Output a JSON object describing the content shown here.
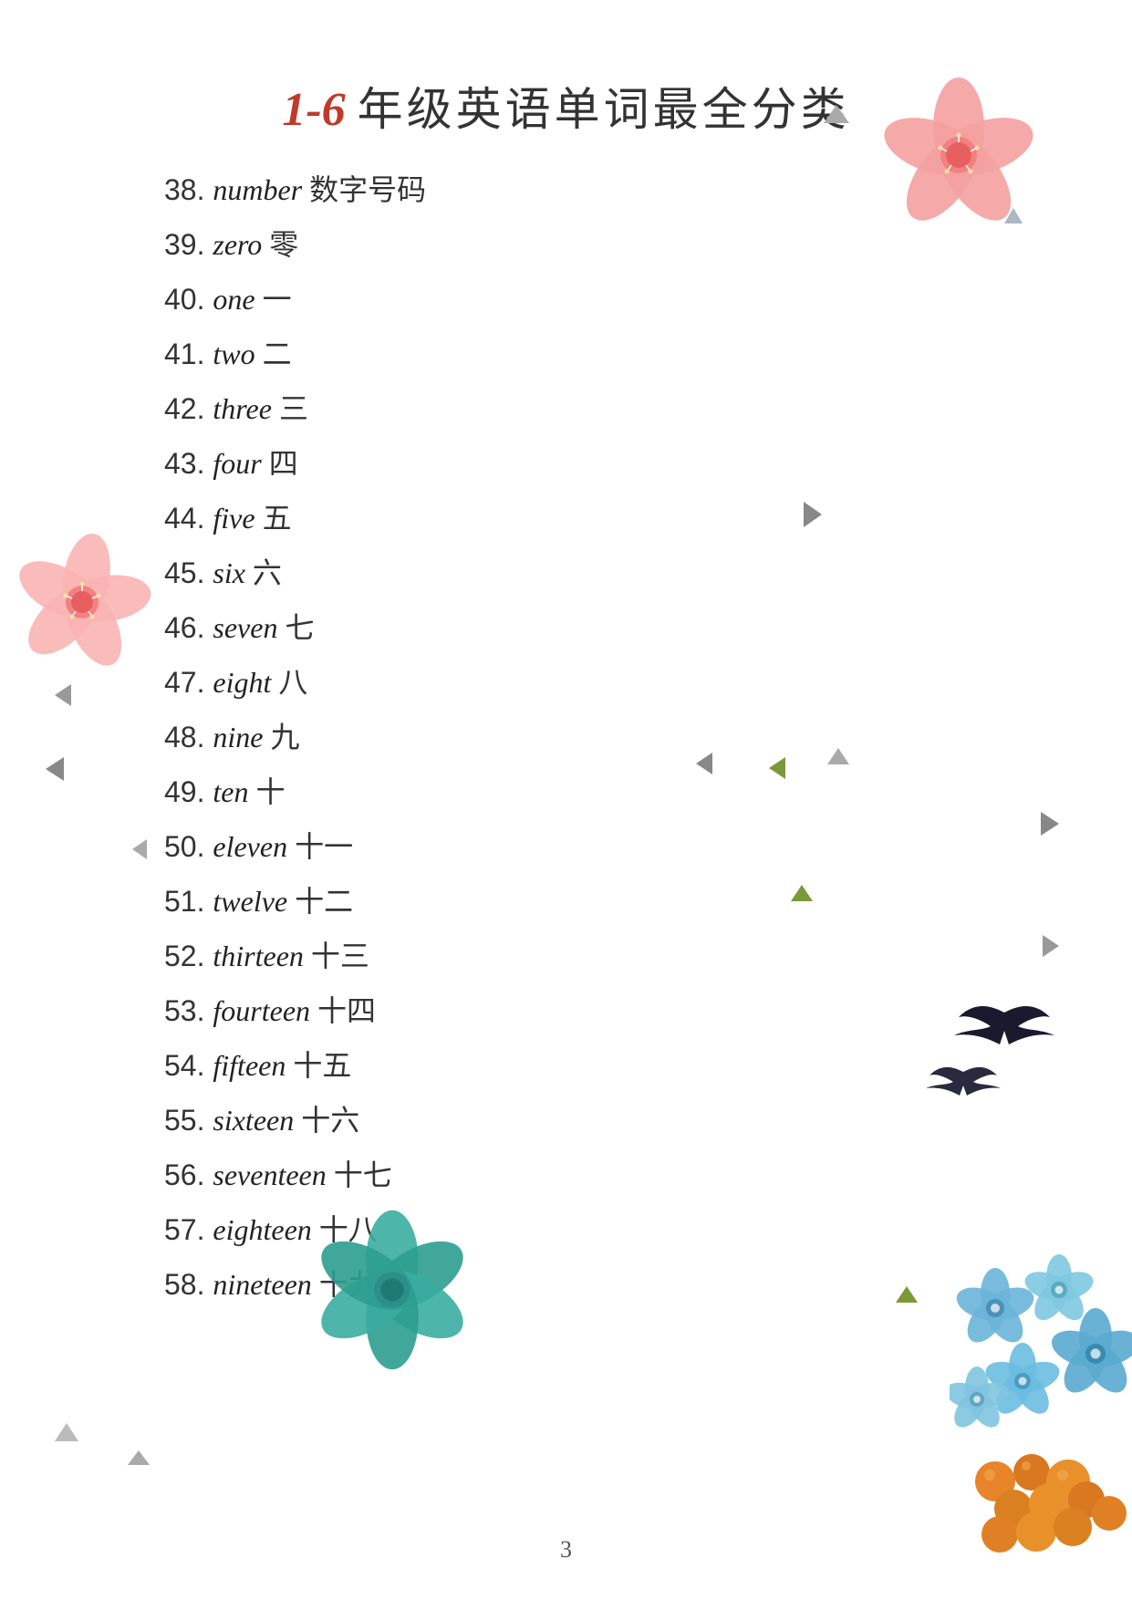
{
  "page": {
    "title": {
      "number": "1-6",
      "text": "年级英语单词最全分类"
    },
    "page_number": "3",
    "words": [
      {
        "num": "38.",
        "english": "number",
        "chinese": "数字号码"
      },
      {
        "num": "39.",
        "english": "zero",
        "chinese": "零"
      },
      {
        "num": "40.",
        "english": "one",
        "chinese": "一"
      },
      {
        "num": "41.",
        "english": "two",
        "chinese": "二"
      },
      {
        "num": "42.",
        "english": "three",
        "chinese": "三"
      },
      {
        "num": "43.",
        "english": "four",
        "chinese": "四"
      },
      {
        "num": "44.",
        "english": "five",
        "chinese": "五"
      },
      {
        "num": "45.",
        "english": "six",
        "chinese": "六"
      },
      {
        "num": "46.",
        "english": "seven",
        "chinese": "七"
      },
      {
        "num": "47.",
        "english": "eight",
        "chinese": "八"
      },
      {
        "num": "48.",
        "english": "nine",
        "chinese": "九"
      },
      {
        "num": "49.",
        "english": "ten",
        "chinese": "十"
      },
      {
        "num": "50.",
        "english": "eleven",
        "chinese": "十一"
      },
      {
        "num": "51.",
        "english": "twelve",
        "chinese": "十二"
      },
      {
        "num": "52.",
        "english": "thirteen",
        "chinese": "十三"
      },
      {
        "num": "53.",
        "english": "fourteen",
        "chinese": "十四"
      },
      {
        "num": "54.",
        "english": "fifteen",
        "chinese": "十五"
      },
      {
        "num": "55.",
        "english": "sixteen",
        "chinese": "十六"
      },
      {
        "num": "56.",
        "english": "seventeen",
        "chinese": "十七"
      },
      {
        "num": "57.",
        "english": "eighteen",
        "chinese": "十八"
      },
      {
        "num": "58.",
        "english": "nineteen",
        "chinese": "十九"
      }
    ]
  }
}
